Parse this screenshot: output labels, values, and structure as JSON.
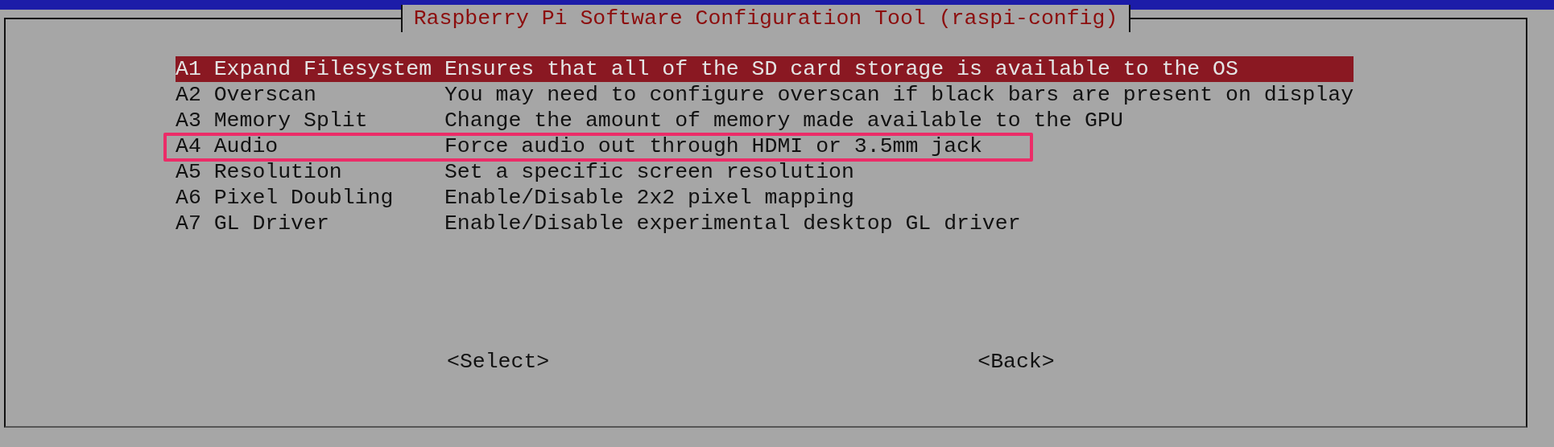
{
  "dialog": {
    "title": "Raspberry Pi Software Configuration Tool (raspi-config)"
  },
  "menu": [
    {
      "label": "A1 Expand Filesystem",
      "description": "Ensures that all of the SD card storage is available to the OS",
      "selected": true,
      "outlined": false
    },
    {
      "label": "A2 Overscan",
      "description": "You may need to configure overscan if black bars are present on display",
      "selected": false,
      "outlined": false
    },
    {
      "label": "A3 Memory Split",
      "description": "Change the amount of memory made available to the GPU",
      "selected": false,
      "outlined": false
    },
    {
      "label": "A4 Audio",
      "description": "Force audio out through HDMI or 3.5mm jack",
      "selected": false,
      "outlined": true
    },
    {
      "label": "A5 Resolution",
      "description": "Set a specific screen resolution",
      "selected": false,
      "outlined": false
    },
    {
      "label": "A6 Pixel Doubling",
      "description": "Enable/Disable 2x2 pixel mapping",
      "selected": false,
      "outlined": false
    },
    {
      "label": "A7 GL Driver",
      "description": "Enable/Disable experimental desktop GL driver",
      "selected": false,
      "outlined": false
    }
  ],
  "buttons": [
    "<Select>",
    "<Back>"
  ]
}
